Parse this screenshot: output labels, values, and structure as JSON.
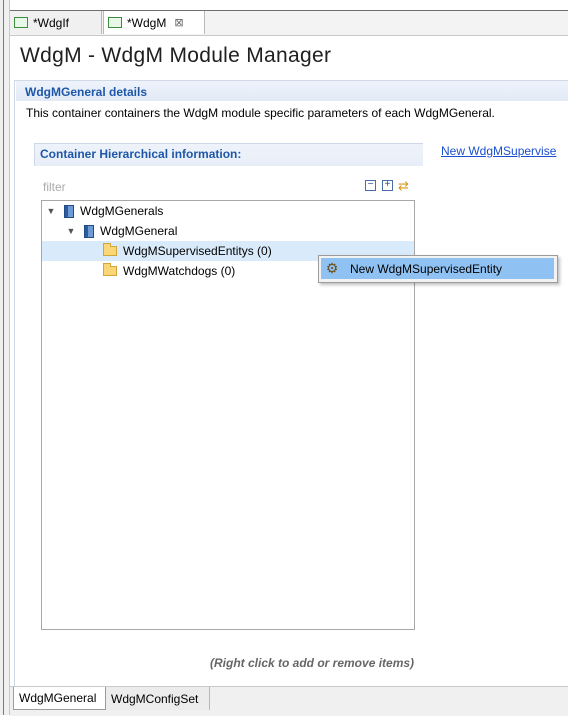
{
  "tabs": [
    {
      "label": "*WdgIf",
      "active": false
    },
    {
      "label": "*WdgM",
      "active": true,
      "close": "⊠"
    }
  ],
  "page": {
    "title": "WdgM - WdgM Module Manager"
  },
  "details": {
    "title": "WdgMGeneral details",
    "description": "This container containers the WdgM module specific parameters of each WdgMGeneral."
  },
  "hierarchy": {
    "title": "Container Hierarchical information:",
    "new_link": "New WdgMSupervise",
    "filter_placeholder": "filter",
    "tree": [
      {
        "label": "WdgMGenerals",
        "level": 0,
        "icon": "book-icon",
        "expanded": true
      },
      {
        "label": "WdgMGeneral",
        "level": 1,
        "icon": "book-icon",
        "expanded": true
      },
      {
        "label": "WdgMSupervisedEntitys (0)",
        "level": 2,
        "icon": "folder-icon",
        "selected": true
      },
      {
        "label": "WdgMWatchdogs (0)",
        "level": 2,
        "icon": "folder-icon"
      }
    ]
  },
  "context_menu": {
    "items": [
      {
        "label": "New WdgMSupervisedEntity",
        "icon": "gear-icon"
      }
    ]
  },
  "hint": "(Right click to add or remove items)",
  "bottom_tabs": [
    {
      "label": "WdgMGeneral",
      "active": true
    },
    {
      "label": "WdgMConfigSet",
      "active": false
    }
  ],
  "colors": {
    "section_title": "#1e57a8",
    "link": "#1a4fd0",
    "selection": "#d9ebfb",
    "menu_highlight": "#8fc2f2"
  }
}
